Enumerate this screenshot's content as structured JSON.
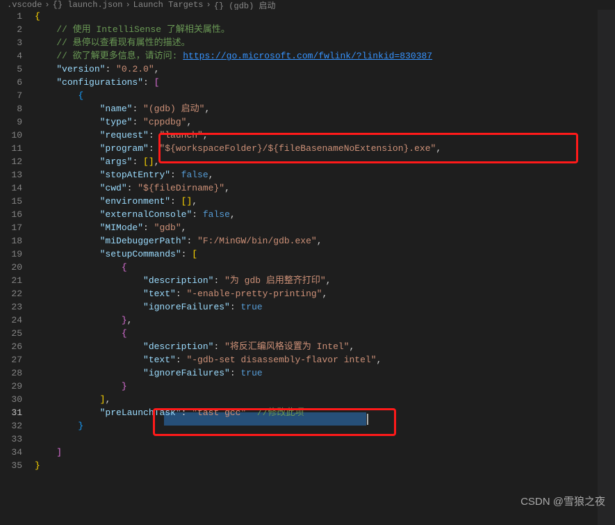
{
  "breadcrumb": {
    "folder": ".vscode",
    "file": "launch.json",
    "path1": "Launch Targets",
    "path2": "{} (gdb) 启动"
  },
  "code": {
    "c1": "// 使用 IntelliSense 了解相关属性。",
    "c2": "// 悬停以查看现有属性的描述。",
    "c3a": "// 欲了解更多信息，请访问: ",
    "c3link": "https://go.microsoft.com/fwlink/?linkid=830387",
    "k_version": "\"version\"",
    "v_version": "\"0.2.0\"",
    "k_configurations": "\"configurations\"",
    "k_name": "\"name\"",
    "v_name": "\"(gdb) 启动\"",
    "k_type": "\"type\"",
    "v_type": "\"cppdbg\"",
    "k_request": "\"request\"",
    "v_request": "\"launch\"",
    "k_program": "\"program\"",
    "v_program": "\"${workspaceFolder}/${fileBasenameNoExtension}.exe\"",
    "k_args": "\"args\"",
    "k_stopAtEntry": "\"stopAtEntry\"",
    "v_false": "false",
    "k_cwd": "\"cwd\"",
    "v_cwd": "\"${fileDirname}\"",
    "k_environment": "\"environment\"",
    "k_externalConsole": "\"externalConsole\"",
    "k_MIMode": "\"MIMode\"",
    "v_MIMode": "\"gdb\"",
    "k_miDebuggerPath": "\"miDebuggerPath\"",
    "v_miDebuggerPath": "\"F:/MinGW/bin/gdb.exe\"",
    "k_setupCommands": "\"setupCommands\"",
    "k_description": "\"description\"",
    "v_desc1": "\"为 gdb 启用整齐打印\"",
    "k_text": "\"text\"",
    "v_text1": "\"-enable-pretty-printing\"",
    "k_ignoreFailures": "\"ignoreFailures\"",
    "v_true": "true",
    "v_desc2": "\"将反汇编风格设置为 Intel\"",
    "v_text2": "\"-gdb-set disassembly-flavor intel\"",
    "k_preLaunchTask": "\"preLaunchTask\"",
    "v_preLaunchTask": "\"tast gcc\"",
    "c_preLaunch": "//修改此项"
  },
  "watermark": "CSDN @雪狼之夜",
  "lineStart": 1,
  "lineEnd": 35
}
